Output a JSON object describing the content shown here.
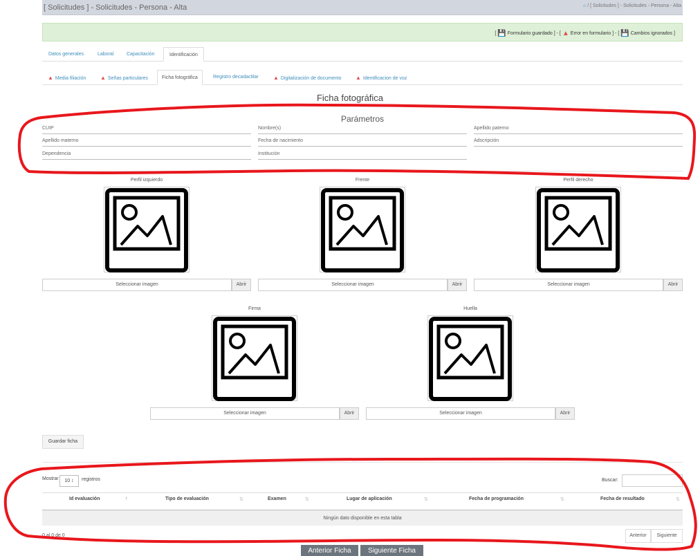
{
  "header": {
    "title": "[ Solicitudes ] - Solicitudes - Persona - Alta",
    "breadcrumb": "[ Solicitudes ] - Solicitudes - Persona - Alta"
  },
  "legend": {
    "saved": "Formulario guardado",
    "error": "Error en formulario",
    "ignored": "Cambios ignorados"
  },
  "tabs": [
    "Datos generales",
    "Laboral",
    "Capacitación",
    "Identificación"
  ],
  "subtabs": [
    "Media filiación",
    "Señas particulares",
    "Ficha fotográfica",
    "Registro decadactilar",
    "Digitalización de documento",
    "Identificacion de voz"
  ],
  "section_title": "Ficha fotográfica",
  "parametros": {
    "title": "Parámetros",
    "fields": [
      "CUIP",
      "Nombre(s)",
      "Apellido paterno",
      "Apellido materno",
      "Fecha de nacimiento",
      "Adscripción",
      "Dependencia",
      "Institución"
    ]
  },
  "photos": {
    "labels": [
      "Perfil izquierdo",
      "Frente",
      "Perfil derecho",
      "Firma",
      "Huella"
    ],
    "select_label": "Seleccionar imagen",
    "open_label": "Abrir"
  },
  "save_button": "Guardar ficha",
  "table": {
    "show_label": "Mostrar",
    "page_size": "10",
    "records_label": "registros",
    "search_label": "Buscar:",
    "columns": [
      "Id evaluación",
      "Tipo de evaluación",
      "Examen",
      "Lugar de aplicación",
      "Fecha de programación",
      "Fecha de resultado"
    ],
    "empty_message": "Ningún dato disponible en esta tabla",
    "info": "0 al 0 de 0",
    "prev": "Anterior",
    "next": "Siguiente"
  },
  "nav": {
    "prev": "Anterior Ficha",
    "next": "Siguiente Ficha"
  },
  "colors": {
    "annotation": "#e8171c",
    "link": "#3c8dbc",
    "success_bg": "#dff0d8"
  }
}
